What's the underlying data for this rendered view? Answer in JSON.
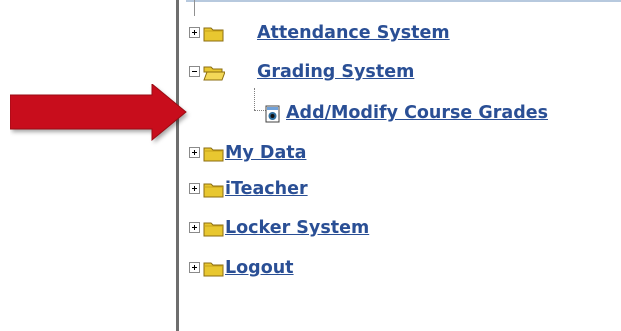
{
  "nav": {
    "items": [
      {
        "label": "Attendance System",
        "expanded": false
      },
      {
        "label": "Grading System",
        "expanded": true,
        "children": [
          {
            "label": "Add/Modify Course Grades"
          }
        ]
      },
      {
        "label": "My Data",
        "expanded": false
      },
      {
        "label": "iTeacher",
        "expanded": false
      },
      {
        "label": "Locker System",
        "expanded": false
      },
      {
        "label": "Logout",
        "expanded": false
      }
    ]
  },
  "colors": {
    "link": "#2a4f95",
    "arrow": "#c8101a",
    "folder": "#e8c730",
    "border": "#6e6e6e"
  },
  "icons": [
    "folder-icon",
    "folder-open-icon",
    "page-icon",
    "plus-icon",
    "minus-icon",
    "arrow-icon"
  ]
}
